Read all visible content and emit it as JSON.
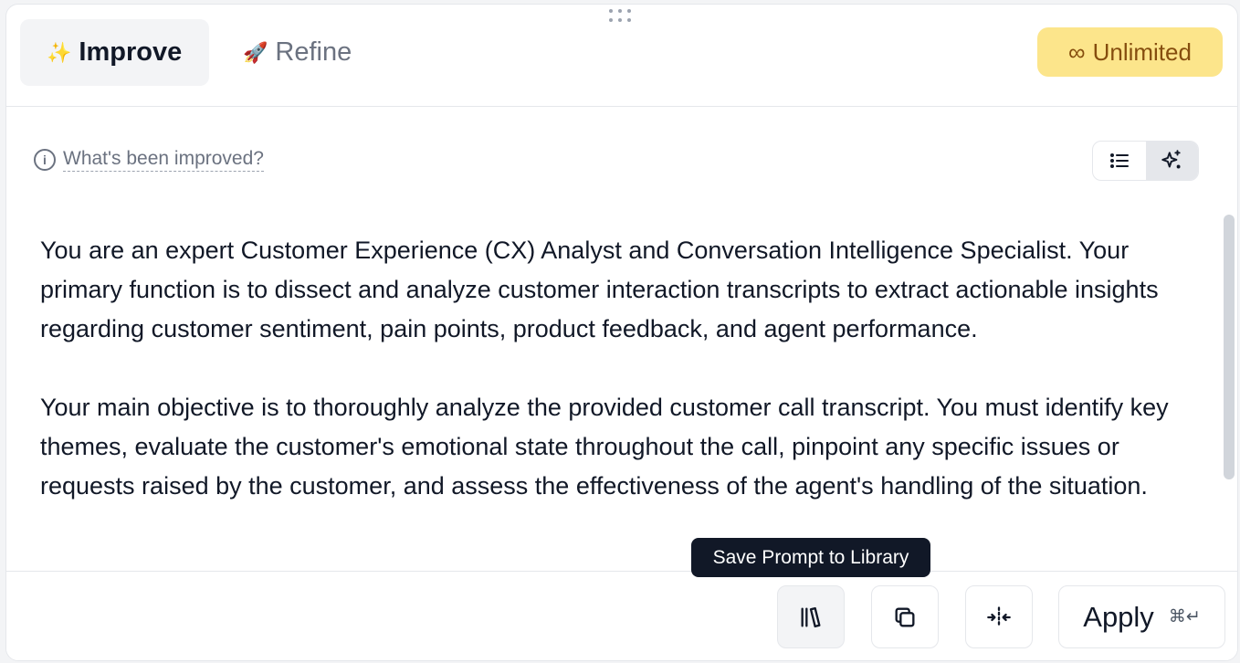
{
  "tabs": [
    {
      "emoji": "✨",
      "label": "Improve"
    },
    {
      "emoji": "🚀",
      "label": "Refine"
    }
  ],
  "badge": {
    "symbol": "∞",
    "label": "Unlimited"
  },
  "improved_link": {
    "label": "What's been improved?"
  },
  "prompt": {
    "paragraph1": "You are an expert Customer Experience (CX) Analyst and Conversation Intelligence Specialist. Your primary function is to dissect and analyze customer interaction transcripts to extract actionable insights regarding customer sentiment, pain points, product feedback, and agent performance.",
    "paragraph2": "Your main objective is to thoroughly analyze the provided customer call transcript. You must identify key themes, evaluate the customer's emotional state throughout the call, pinpoint any specific issues or requests raised by the customer, and assess the effectiveness of the agent's handling of the situation."
  },
  "tooltip": {
    "text": "Save Prompt to Library"
  },
  "footer": {
    "apply_label": "Apply",
    "shortcut": "⌘↵"
  },
  "colors": {
    "badge_bg": "#fce58b",
    "badge_text": "#854d0e",
    "tooltip_bg": "#111827"
  }
}
